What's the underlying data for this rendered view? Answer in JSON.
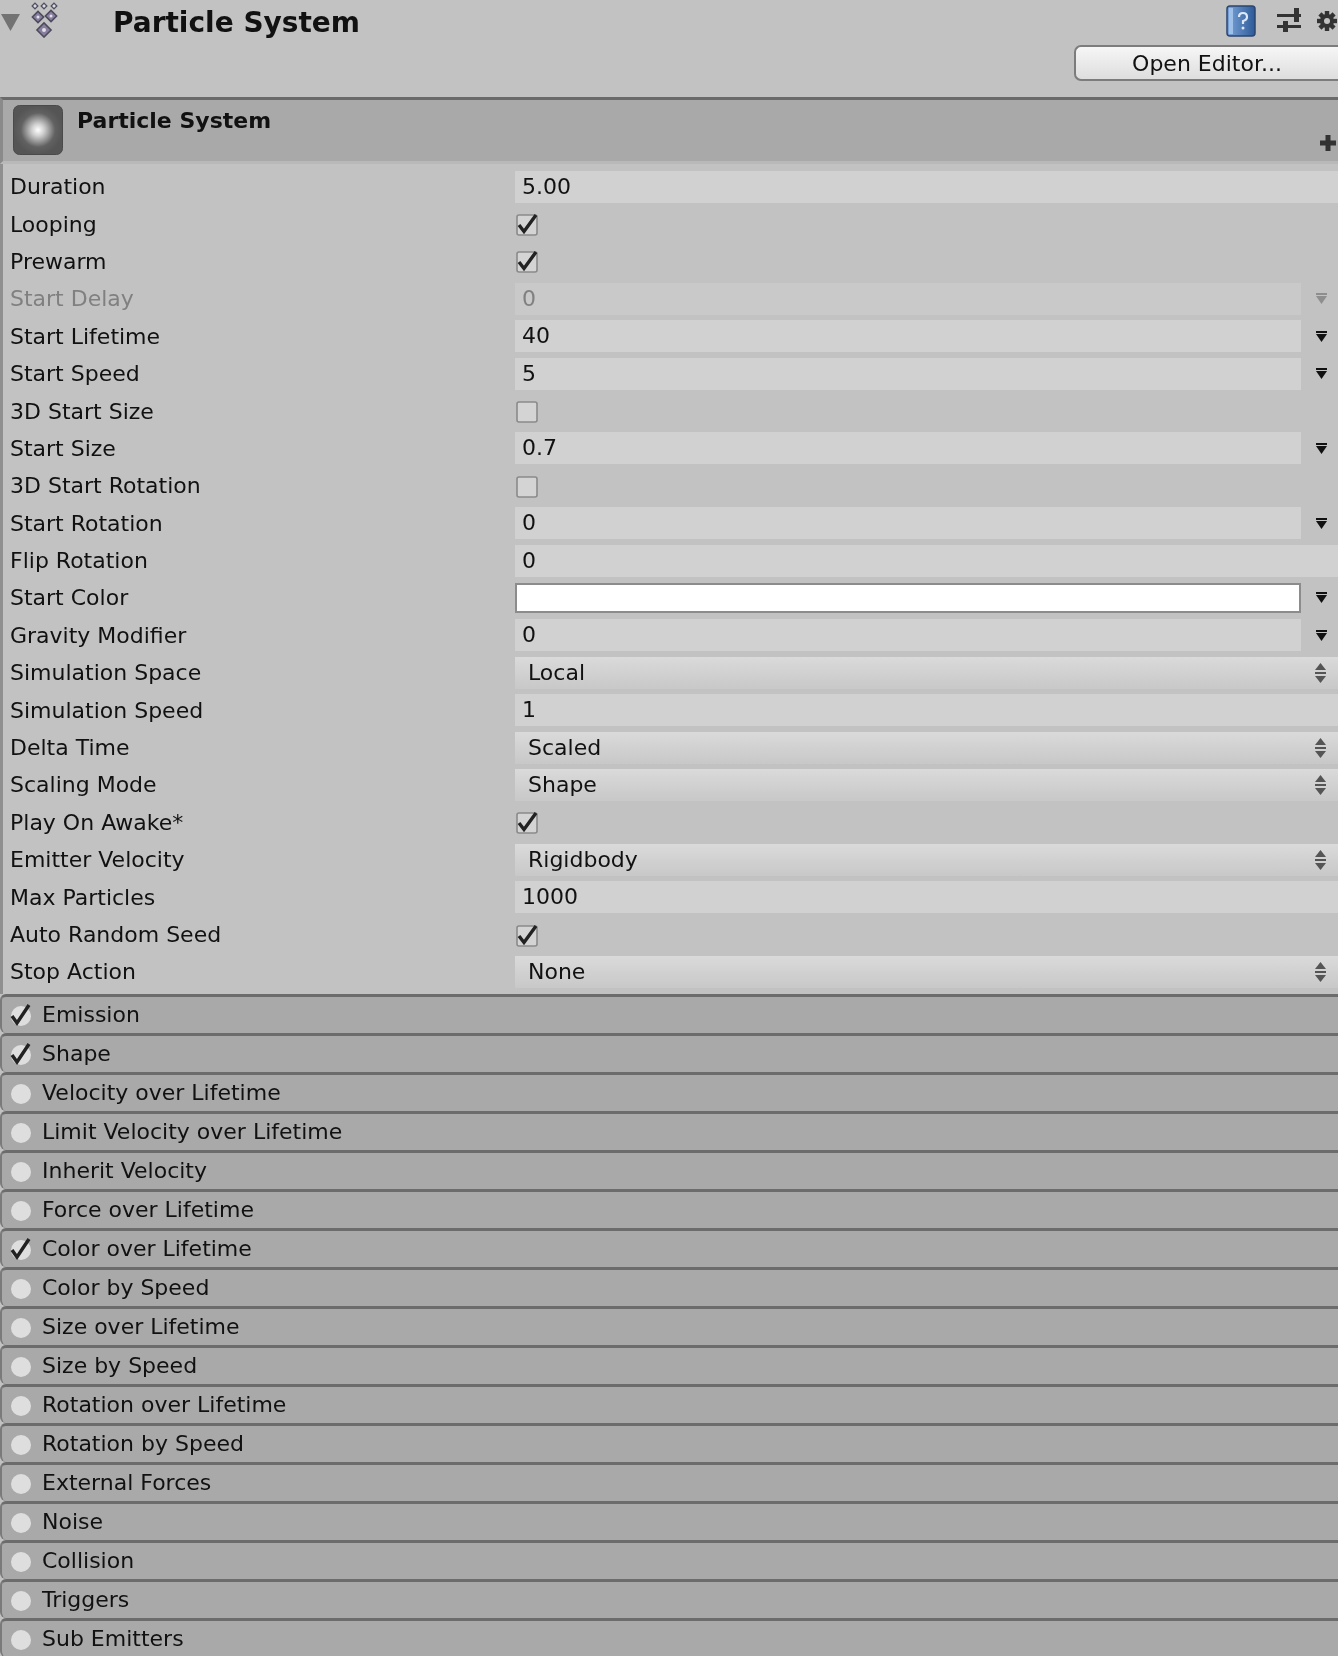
{
  "inspector_header": {
    "title": "Particle System",
    "open_editor_button": "Open Editor..."
  },
  "component": {
    "title": "Particle System"
  },
  "properties": [
    {
      "label": "Duration",
      "kind": "number",
      "value": "5.00",
      "curve_menu": false,
      "disabled": false
    },
    {
      "label": "Looping",
      "kind": "checkbox",
      "checked": true,
      "curve_menu": false,
      "disabled": false
    },
    {
      "label": "Prewarm",
      "kind": "checkbox",
      "checked": true,
      "curve_menu": false,
      "disabled": false
    },
    {
      "label": "Start Delay",
      "kind": "number",
      "value": "0",
      "curve_menu": true,
      "disabled": true
    },
    {
      "label": "Start Lifetime",
      "kind": "number",
      "value": "40",
      "curve_menu": true,
      "disabled": false
    },
    {
      "label": "Start Speed",
      "kind": "number",
      "value": "5",
      "curve_menu": true,
      "disabled": false
    },
    {
      "label": "3D Start Size",
      "kind": "checkbox",
      "checked": false,
      "curve_menu": false,
      "disabled": false
    },
    {
      "label": "Start Size",
      "kind": "number",
      "value": "0.7",
      "curve_menu": true,
      "disabled": false
    },
    {
      "label": "3D Start Rotation",
      "kind": "checkbox",
      "checked": false,
      "curve_menu": false,
      "disabled": false
    },
    {
      "label": "Start Rotation",
      "kind": "number",
      "value": "0",
      "curve_menu": true,
      "disabled": false
    },
    {
      "label": "Flip Rotation",
      "kind": "number",
      "value": "0",
      "curve_menu": false,
      "disabled": false
    },
    {
      "label": "Start Color",
      "kind": "color",
      "color": "#ffffff",
      "curve_menu": true,
      "disabled": false
    },
    {
      "label": "Gravity Modifier",
      "kind": "number",
      "value": "0",
      "curve_menu": true,
      "disabled": false
    },
    {
      "label": "Simulation Space",
      "kind": "dropdown",
      "value": "Local",
      "curve_menu": false,
      "disabled": false
    },
    {
      "label": "Simulation Speed",
      "kind": "number",
      "value": "1",
      "curve_menu": false,
      "disabled": false
    },
    {
      "label": "Delta Time",
      "kind": "dropdown",
      "value": "Scaled",
      "curve_menu": false,
      "disabled": false
    },
    {
      "label": "Scaling Mode",
      "kind": "dropdown",
      "value": "Shape",
      "curve_menu": false,
      "disabled": false
    },
    {
      "label": "Play On Awake*",
      "kind": "checkbox",
      "checked": true,
      "curve_menu": false,
      "disabled": false
    },
    {
      "label": "Emitter Velocity",
      "kind": "dropdown",
      "value": "Rigidbody",
      "curve_menu": false,
      "disabled": false
    },
    {
      "label": "Max Particles",
      "kind": "number",
      "value": "1000",
      "curve_menu": false,
      "disabled": false
    },
    {
      "label": "Auto Random Seed",
      "kind": "checkbox",
      "checked": true,
      "curve_menu": false,
      "disabled": false
    },
    {
      "label": "Stop Action",
      "kind": "dropdown",
      "value": "None",
      "curve_menu": false,
      "disabled": false
    }
  ],
  "modules": [
    {
      "label": "Emission",
      "checked": true
    },
    {
      "label": "Shape",
      "checked": true
    },
    {
      "label": "Velocity over Lifetime",
      "checked": false
    },
    {
      "label": "Limit Velocity over Lifetime",
      "checked": false
    },
    {
      "label": "Inherit Velocity",
      "checked": false
    },
    {
      "label": "Force over Lifetime",
      "checked": false
    },
    {
      "label": "Color over Lifetime",
      "checked": true
    },
    {
      "label": "Color by Speed",
      "checked": false
    },
    {
      "label": "Size over Lifetime",
      "checked": false
    },
    {
      "label": "Size by Speed",
      "checked": false
    },
    {
      "label": "Rotation over Lifetime",
      "checked": false
    },
    {
      "label": "Rotation by Speed",
      "checked": false
    },
    {
      "label": "External Forces",
      "checked": false
    },
    {
      "label": "Noise",
      "checked": false
    },
    {
      "label": "Collision",
      "checked": false
    },
    {
      "label": "Triggers",
      "checked": false
    },
    {
      "label": "Sub Emitters",
      "checked": false
    }
  ]
}
